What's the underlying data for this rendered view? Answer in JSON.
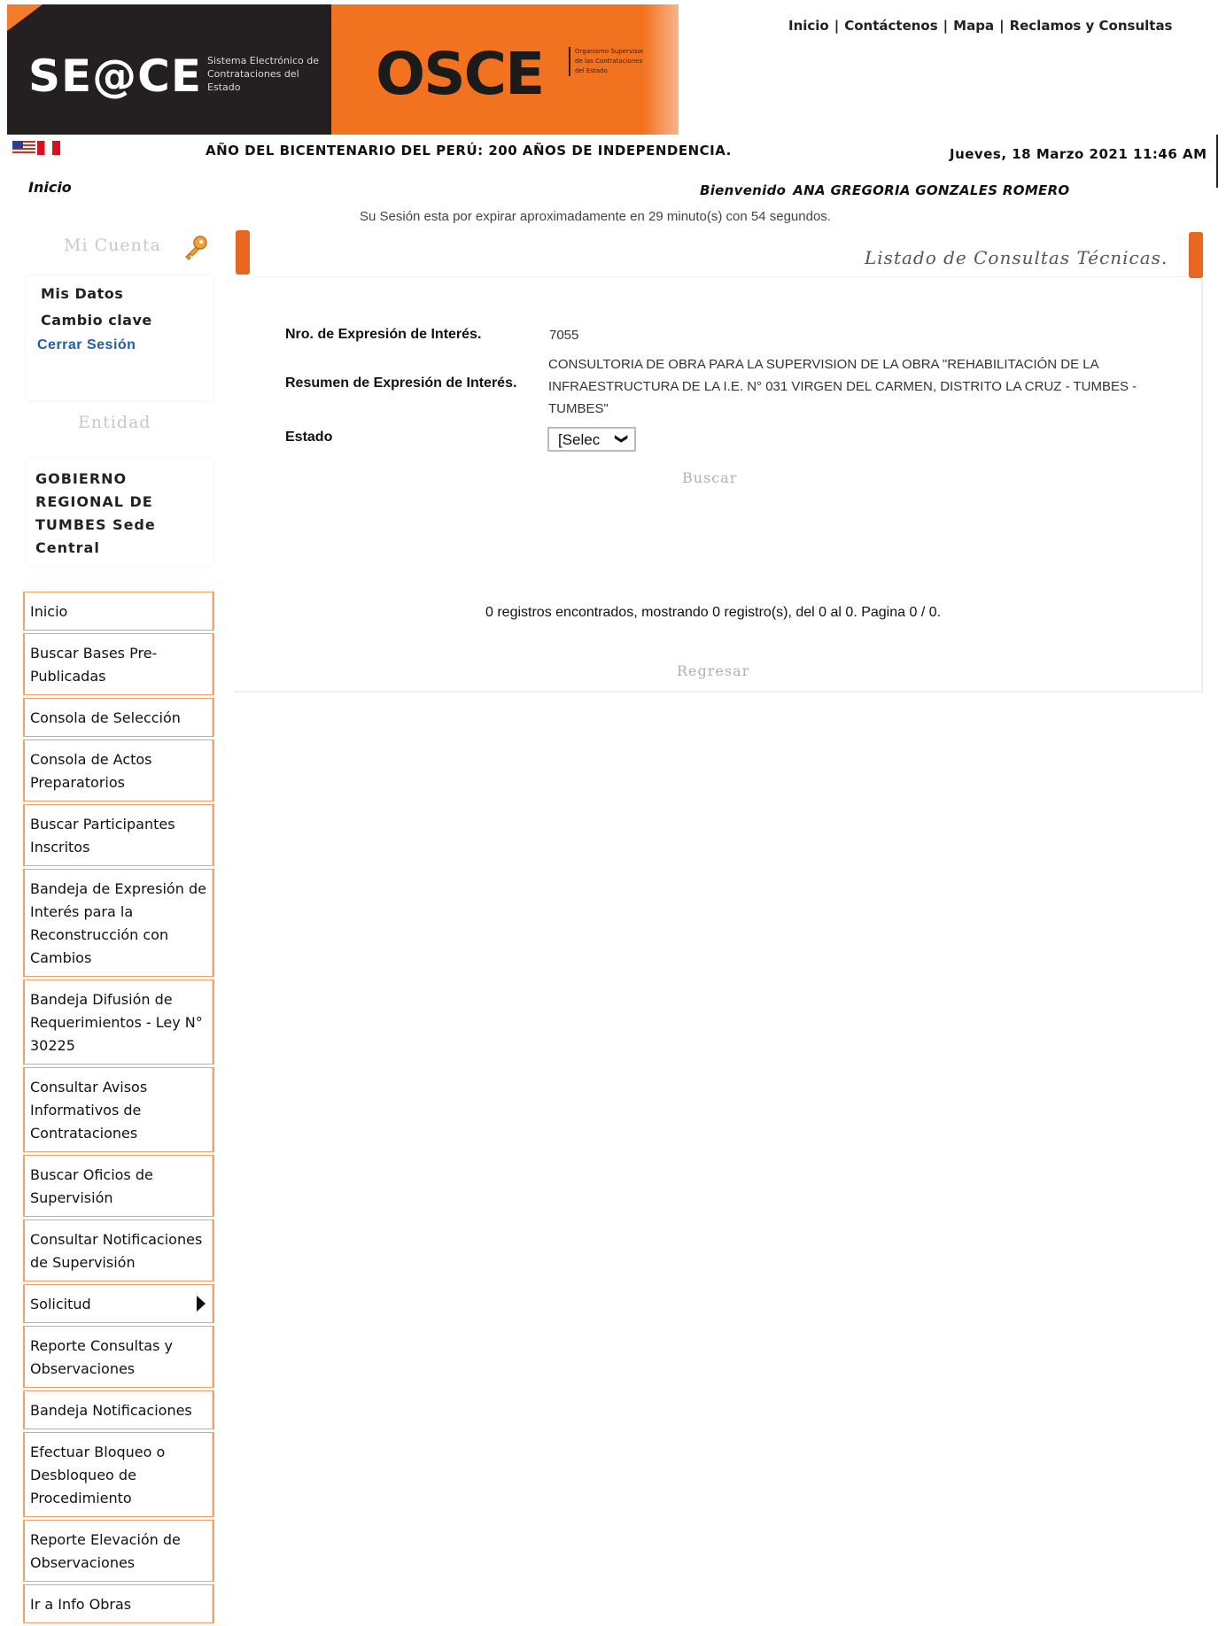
{
  "header": {
    "seace_logo": "SE@CE",
    "seace_subtitle": "Sistema Electrónico de Contrataciones del Estado",
    "osce_logo": "OSCE",
    "osce_subtitle": "Organismo Supervisor de las Contrataciones del Estado",
    "colors": {
      "seace_bg": "#241f20",
      "osce_bg": "#f2731f",
      "accent": "#e8661f"
    }
  },
  "top_links": [
    "Inicio",
    "Contáctenos",
    "Mapa",
    "Reclamos y Consultas"
  ],
  "flags": [
    "us-flag-icon",
    "peru-flag-icon"
  ],
  "year_title": "AÑO DEL BICENTENARIO DEL PERÚ: 200 AÑOS DE INDEPENDENCIA.",
  "datetime": "Jueves, 18 Marzo 2021 11:46 AM",
  "breadcrumb": "Inicio",
  "welcome": {
    "label": "Bienvenido",
    "user": "ANA GREGORIA GONZALES ROMERO"
  },
  "session_notice": "Su Sesión esta por expirar aproximadamente en 29 minuto(s) con 54 segundos.",
  "sidebar": {
    "account_title": "Mi Cuenta",
    "account_icon": "key-icon",
    "account_items": [
      "Mis Datos",
      "Cambio clave",
      "Cerrar Sesión"
    ],
    "entity_title": "Entidad",
    "entity_name": "GOBIERNO REGIONAL DE TUMBES Sede Central",
    "menu": [
      "Inicio",
      "Buscar Bases Pre-Publicadas",
      "Consola de Selección",
      "Consola de Actos Preparatorios",
      "Buscar Participantes Inscritos",
      "Bandeja de Expresión de Interés para la Reconstrucción con Cambios",
      "Bandeja Difusión de Requerimientos - Ley N° 30225",
      "Consultar Avisos Informativos de Contrataciones",
      "Buscar Oficios de Supervisión",
      "Consultar Notificaciones de Supervisión",
      "Solicitud",
      "Reporte Consultas y Observaciones",
      "Bandeja Notificaciones",
      "Efectuar Bloqueo o Desbloqueo de Procedimiento",
      "Reporte Elevación de Observaciones",
      "Ir a Info Obras"
    ]
  },
  "main": {
    "title": "Listado de Consultas Técnicas.",
    "fields": {
      "nro_label": "Nro. de Expresión de Interés.",
      "nro_value": "7055",
      "resumen_label": "Resumen de Expresión de Interés.",
      "resumen_value": "CONSULTORIA DE OBRA PARA LA SUPERVISION DE LA OBRA \"REHABILITACIÓN DE LA INFRAESTRUCTURA DE LA I.E. N° 031 VIRGEN DEL CARMEN, DISTRITO LA CRUZ - TUMBES - TUMBES\"",
      "estado_label": "Estado",
      "estado_value": "[Selec"
    },
    "buscar_label": "Buscar",
    "results_text": "0 registros encontrados, mostrando 0 registro(s), del 0 al 0. Pagina 0 / 0.",
    "regresar_label": "Regresar"
  }
}
